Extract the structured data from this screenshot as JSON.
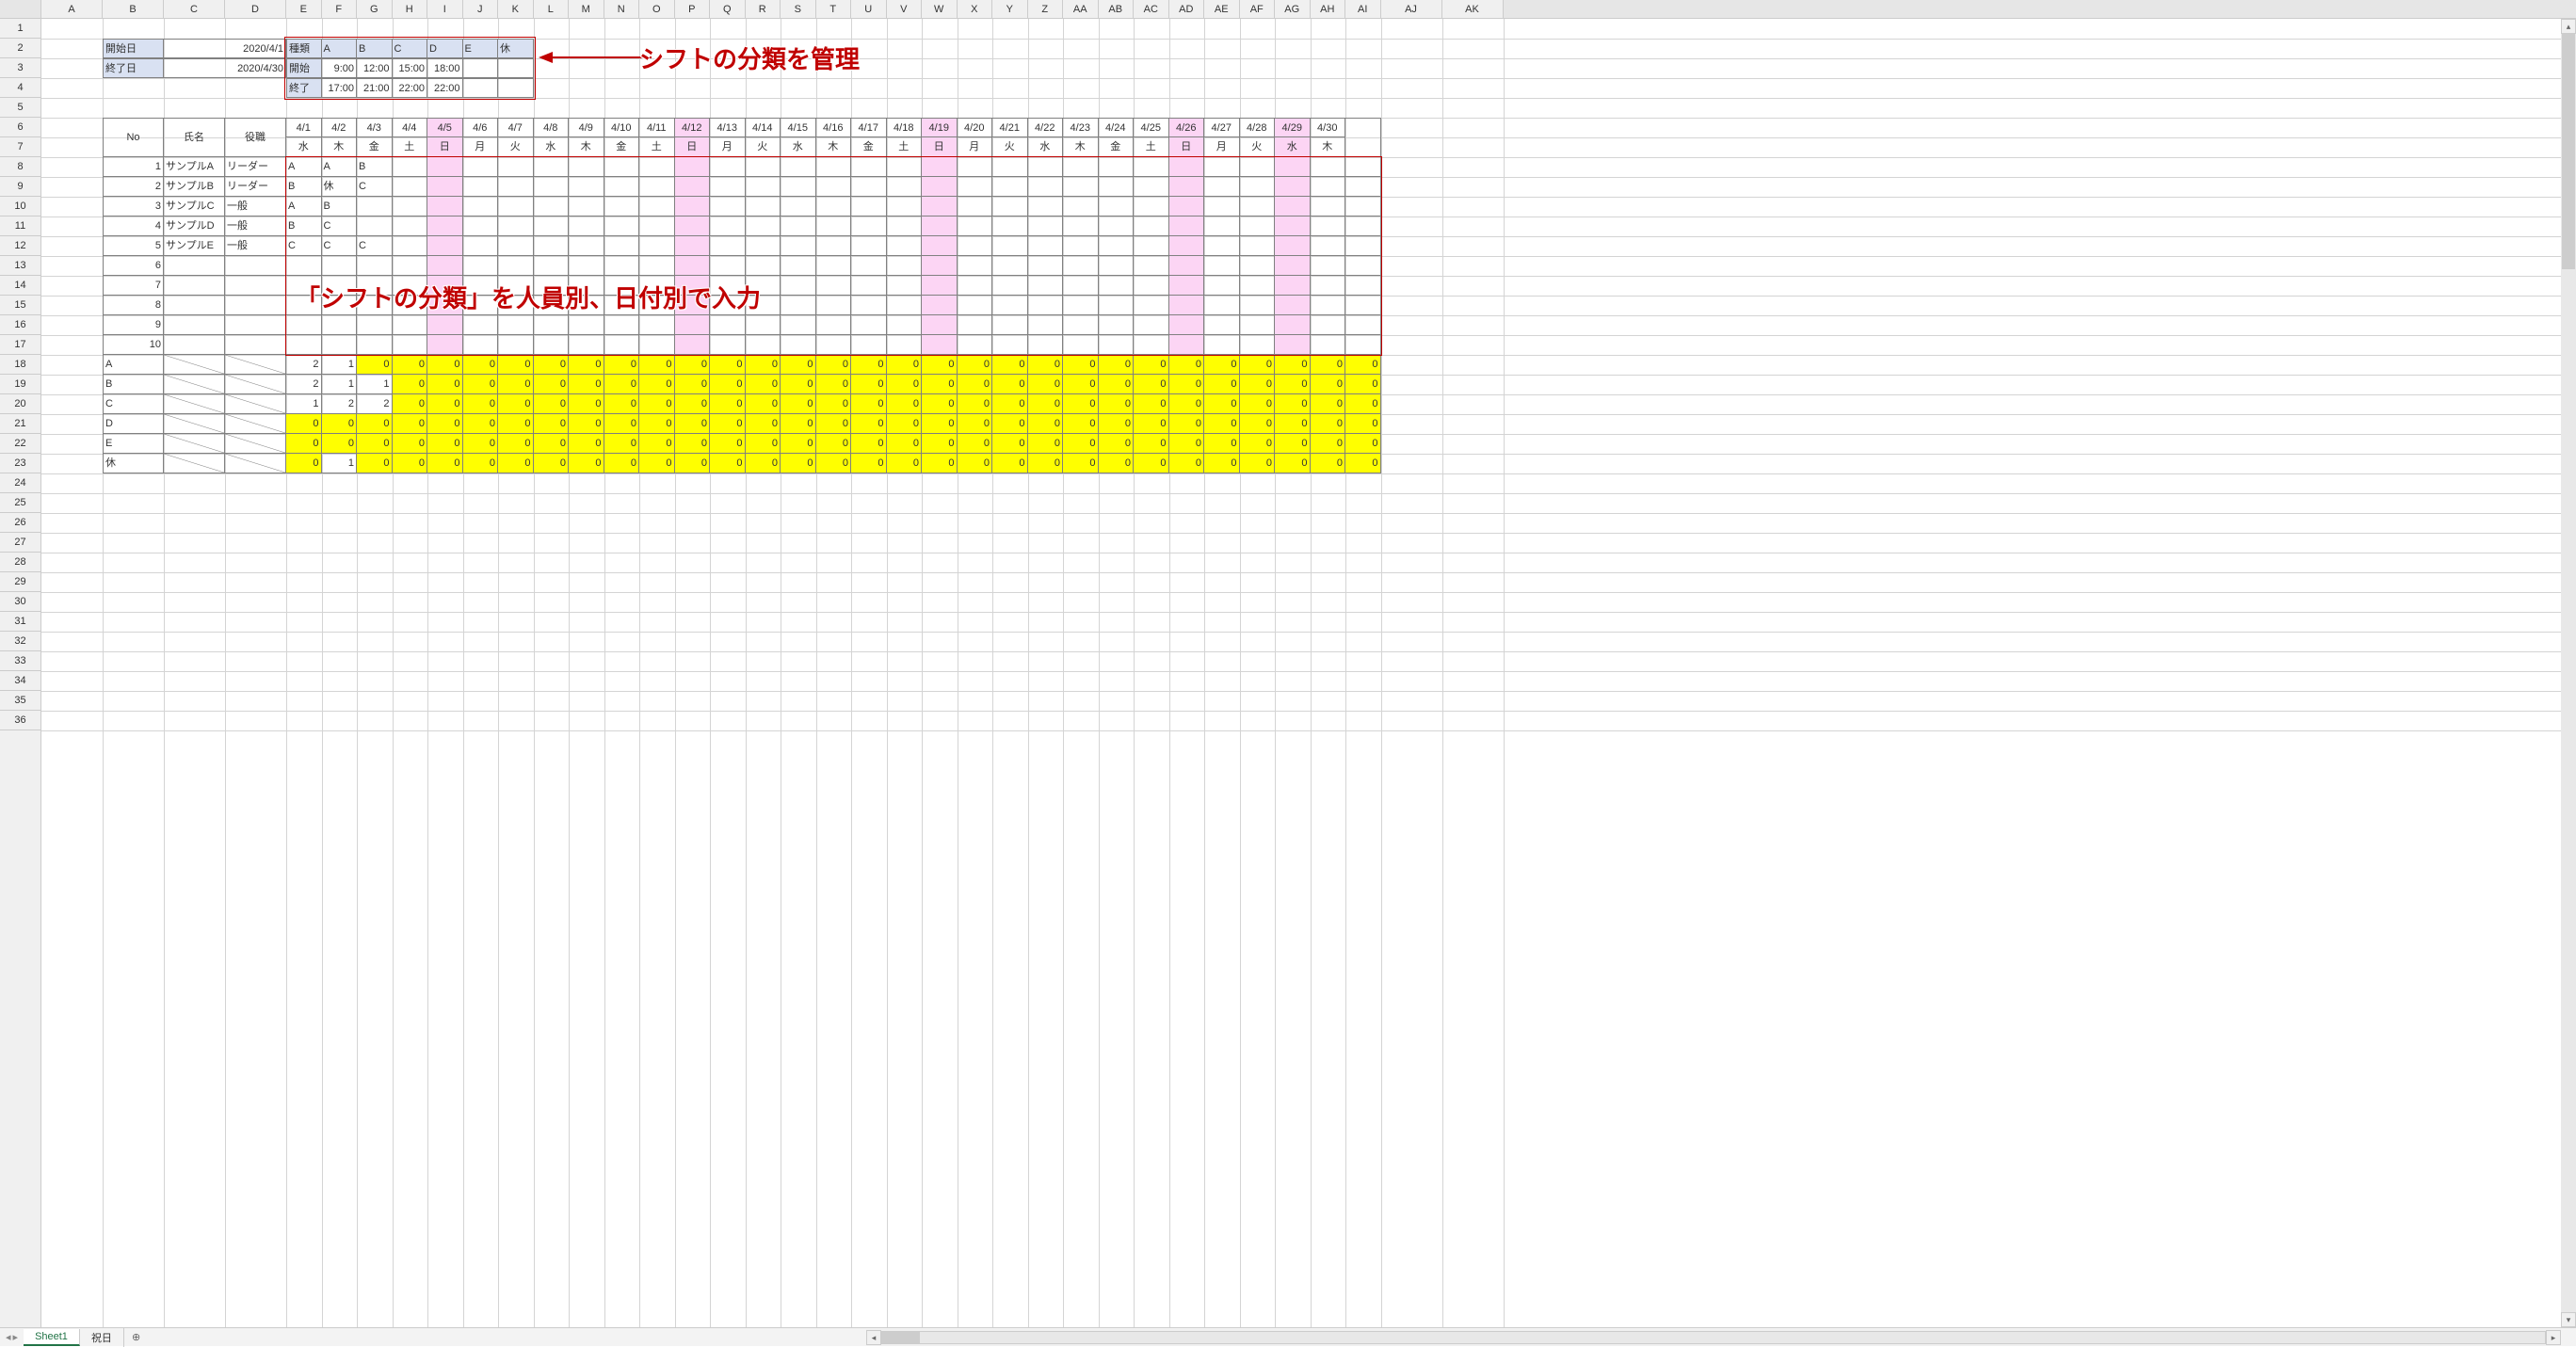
{
  "columns": [
    "A",
    "B",
    "C",
    "D",
    "E",
    "F",
    "G",
    "H",
    "I",
    "J",
    "K",
    "L",
    "M",
    "N",
    "O",
    "P",
    "Q",
    "R",
    "S",
    "T",
    "U",
    "V",
    "W",
    "X",
    "Y",
    "Z",
    "AA",
    "AB",
    "AC",
    "AD",
    "AE",
    "AF",
    "AG",
    "AH",
    "AI",
    "AJ",
    "AK"
  ],
  "col_widths": {
    "A": 65,
    "B": 65,
    "C": 65,
    "D": 65,
    "narrow": 37.5,
    "rest": 65
  },
  "row_count_visible": 36,
  "date_range": {
    "labels": [
      "開始日",
      "終了日"
    ],
    "values": [
      "2020/4/1",
      "2020/4/30"
    ]
  },
  "shift_types": {
    "header": "種類",
    "columns": [
      "A",
      "B",
      "C",
      "D",
      "E",
      "休"
    ],
    "rows": [
      {
        "label": "開始",
        "values": [
          "9:00",
          "12:00",
          "15:00",
          "18:00",
          "",
          ""
        ]
      },
      {
        "label": "終了",
        "values": [
          "17:00",
          "21:00",
          "22:00",
          "22:00",
          "",
          ""
        ]
      }
    ]
  },
  "schedule_header": {
    "no": "No",
    "name": "氏名",
    "role": "役職",
    "dates": [
      "4/1",
      "4/2",
      "4/3",
      "4/4",
      "4/5",
      "4/6",
      "4/7",
      "4/8",
      "4/9",
      "4/10",
      "4/11",
      "4/12",
      "4/13",
      "4/14",
      "4/15",
      "4/16",
      "4/17",
      "4/18",
      "4/19",
      "4/20",
      "4/21",
      "4/22",
      "4/23",
      "4/24",
      "4/25",
      "4/26",
      "4/27",
      "4/28",
      "4/29",
      "4/30"
    ],
    "weekdays": [
      "水",
      "木",
      "金",
      "土",
      "日",
      "月",
      "火",
      "水",
      "木",
      "金",
      "土",
      "日",
      "月",
      "火",
      "水",
      "木",
      "金",
      "土",
      "日",
      "月",
      "火",
      "水",
      "木",
      "金",
      "土",
      "日",
      "月",
      "火",
      "水",
      "木"
    ]
  },
  "sunday_columns": [
    4,
    11,
    18,
    25,
    28
  ],
  "saturday_columns": [
    3,
    10,
    17,
    24
  ],
  "staff": [
    {
      "no": 1,
      "name": "サンプルA",
      "role": "リーダー",
      "shifts": [
        "A",
        "A",
        "B"
      ]
    },
    {
      "no": 2,
      "name": "サンプルB",
      "role": "リーダー",
      "shifts": [
        "B",
        "休",
        "C"
      ]
    },
    {
      "no": 3,
      "name": "サンプルC",
      "role": "一般",
      "shifts": [
        "A",
        "B",
        ""
      ]
    },
    {
      "no": 4,
      "name": "サンプルD",
      "role": "一般",
      "shifts": [
        "B",
        "C",
        ""
      ]
    },
    {
      "no": 5,
      "name": "サンプルE",
      "role": "一般",
      "shifts": [
        "C",
        "C",
        "C"
      ]
    },
    {
      "no": 6,
      "name": "",
      "role": "",
      "shifts": []
    },
    {
      "no": 7,
      "name": "",
      "role": "",
      "shifts": []
    },
    {
      "no": 8,
      "name": "",
      "role": "",
      "shifts": []
    },
    {
      "no": 9,
      "name": "",
      "role": "",
      "shifts": []
    },
    {
      "no": 10,
      "name": "",
      "role": "",
      "shifts": []
    }
  ],
  "summary": [
    {
      "label": "A",
      "values": [
        2,
        1,
        0
      ]
    },
    {
      "label": "B",
      "values": [
        2,
        1,
        1
      ]
    },
    {
      "label": "C",
      "values": [
        1,
        2,
        2
      ]
    },
    {
      "label": "D",
      "values": [
        0,
        0,
        0
      ]
    },
    {
      "label": "E",
      "values": [
        0,
        0,
        0
      ]
    },
    {
      "label": "休",
      "values": [
        0,
        1,
        0
      ]
    }
  ],
  "annotations": {
    "top": "シフトの分類を管理",
    "middle": "「シフトの分類」を人員別、日付別で入力"
  },
  "tabs": {
    "active": "Sheet1",
    "other": "祝日"
  },
  "chart_data": {
    "type": "table",
    "title": "シフト管理表",
    "date_range": {
      "start": "2020/4/1",
      "end": "2020/4/30"
    },
    "shift_definitions": [
      {
        "code": "A",
        "start": "9:00",
        "end": "17:00"
      },
      {
        "code": "B",
        "start": "12:00",
        "end": "21:00"
      },
      {
        "code": "C",
        "start": "15:00",
        "end": "22:00"
      },
      {
        "code": "D",
        "start": "18:00",
        "end": "22:00"
      },
      {
        "code": "E",
        "start": "",
        "end": ""
      },
      {
        "code": "休",
        "start": "",
        "end": ""
      }
    ],
    "assignments": [
      {
        "staff": "サンプルA",
        "role": "リーダー",
        "4/1": "A",
        "4/2": "A",
        "4/3": "B"
      },
      {
        "staff": "サンプルB",
        "role": "リーダー",
        "4/1": "B",
        "4/2": "休",
        "4/3": "C"
      },
      {
        "staff": "サンプルC",
        "role": "一般",
        "4/1": "A",
        "4/2": "B"
      },
      {
        "staff": "サンプルD",
        "role": "一般",
        "4/1": "B",
        "4/2": "C"
      },
      {
        "staff": "サンプルE",
        "role": "一般",
        "4/1": "C",
        "4/2": "C",
        "4/3": "C"
      }
    ],
    "daily_counts_by_shift": {
      "A": {
        "4/1": 2,
        "4/2": 1,
        "4/3": 0
      },
      "B": {
        "4/1": 2,
        "4/2": 1,
        "4/3": 1
      },
      "C": {
        "4/1": 1,
        "4/2": 2,
        "4/3": 2
      },
      "D": {
        "4/1": 0,
        "4/2": 0,
        "4/3": 0
      },
      "E": {
        "4/1": 0,
        "4/2": 0,
        "4/3": 0
      },
      "休": {
        "4/1": 0,
        "4/2": 1,
        "4/3": 0
      }
    }
  }
}
